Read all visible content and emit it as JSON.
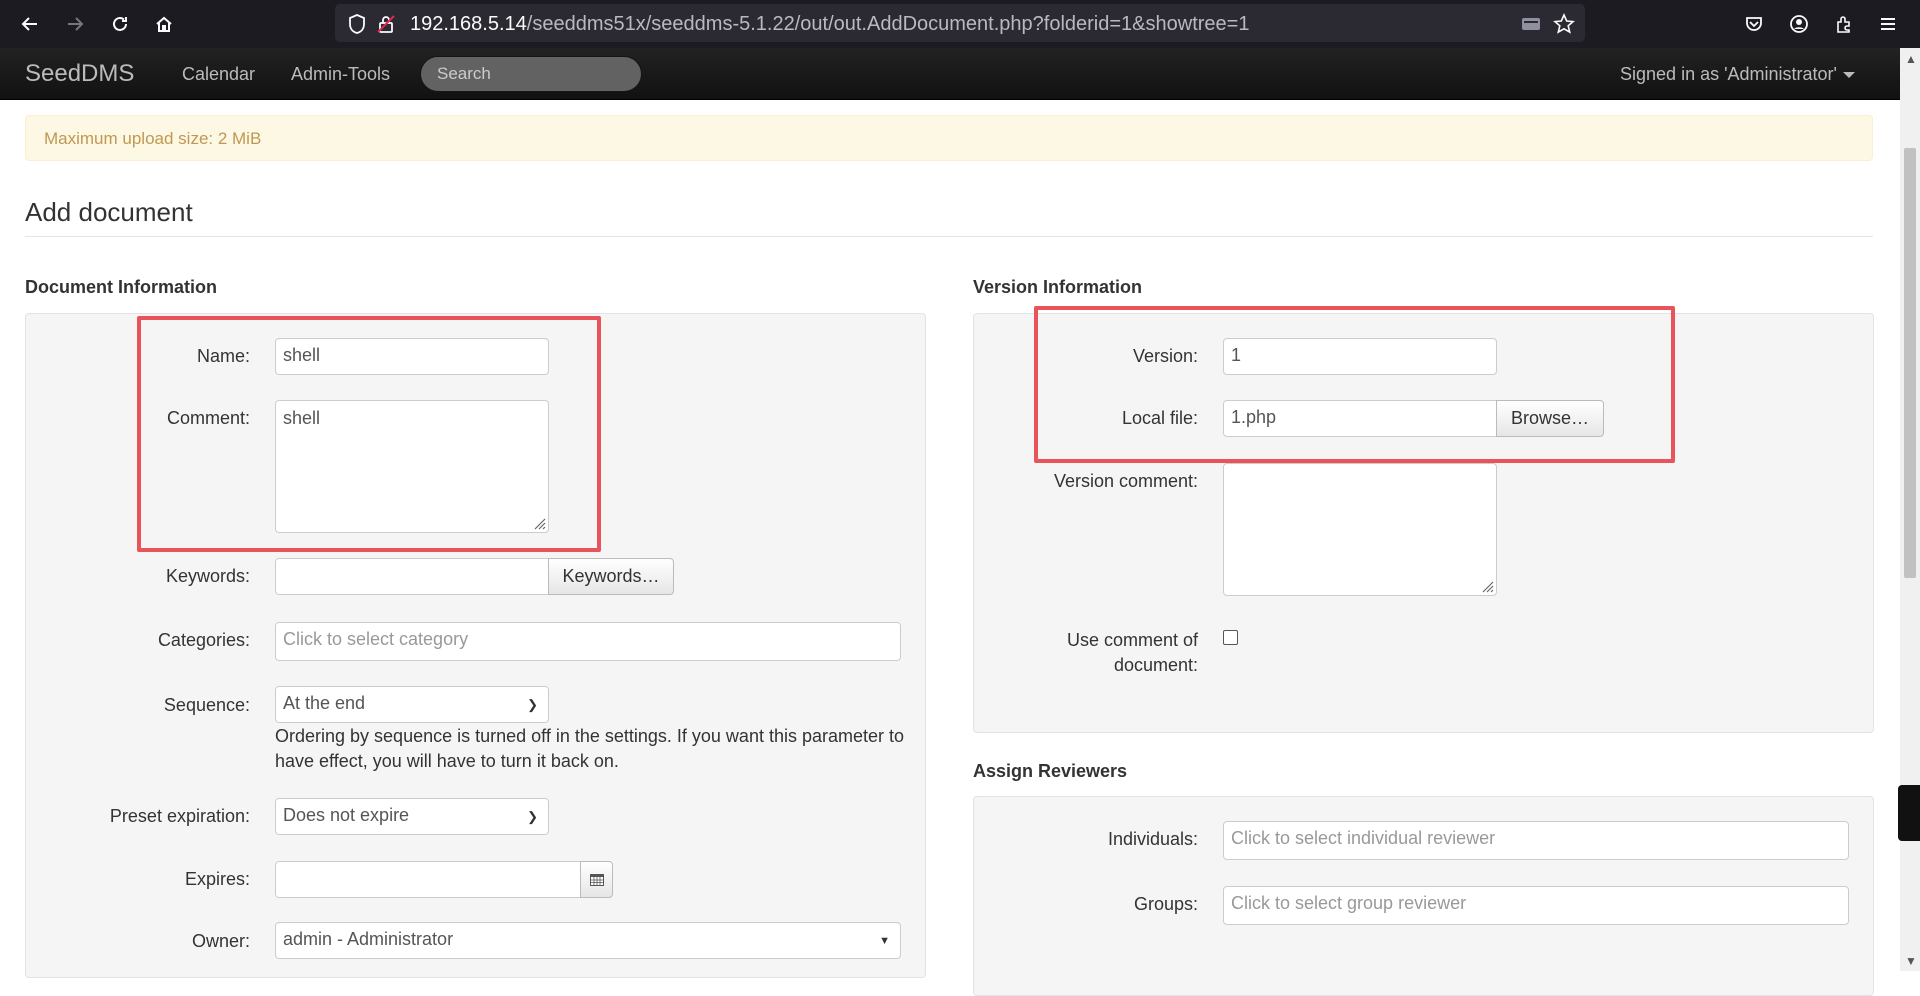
{
  "browser": {
    "url_host": "192.168.5.14",
    "url_path": "/seeddms51x/seeddms-5.1.22/out/out.AddDocument.php?folderid=1&showtree=1"
  },
  "navbar": {
    "brand": "SeedDMS",
    "links": [
      "Calendar",
      "Admin-Tools"
    ],
    "search_placeholder": "Search",
    "signed_in": "Signed in as 'Administrator'"
  },
  "alert": {
    "text": "Maximum upload size: 2 MiB"
  },
  "page": {
    "title": "Add document"
  },
  "document_info": {
    "heading": "Document Information",
    "name_label": "Name:",
    "name_value": "shell",
    "comment_label": "Comment:",
    "comment_value": "shell",
    "keywords_label": "Keywords:",
    "keywords_button": "Keywords…",
    "categories_label": "Categories:",
    "categories_placeholder": "Click to select category",
    "sequence_label": "Sequence:",
    "sequence_value": "At the end",
    "sequence_help_1": "Ordering by sequence is turned off in the settings. If you want this parameter to",
    "sequence_help_2": "have effect, you will have to turn it back on.",
    "expiration_label": "Preset expiration:",
    "expiration_value": "Does not expire",
    "expires_label": "Expires:",
    "owner_label": "Owner:",
    "owner_value": "admin - Administrator"
  },
  "version_info": {
    "heading": "Version Information",
    "version_label": "Version:",
    "version_value": "1",
    "local_file_label": "Local file:",
    "local_file_value": "1.php",
    "browse_button": "Browse…",
    "version_comment_label": "Version comment:",
    "use_comment_label_1": "Use comment of",
    "use_comment_label_2": "document:"
  },
  "reviewers": {
    "heading": "Assign Reviewers",
    "individuals_label": "Individuals:",
    "individuals_placeholder": "Click to select individual reviewer",
    "groups_label": "Groups:",
    "groups_placeholder": "Click to select group reviewer"
  },
  "colors": {
    "highlight": "#e8545a",
    "alert_bg": "#fcf8e3",
    "navbar_bg": "#1b1b1b"
  }
}
